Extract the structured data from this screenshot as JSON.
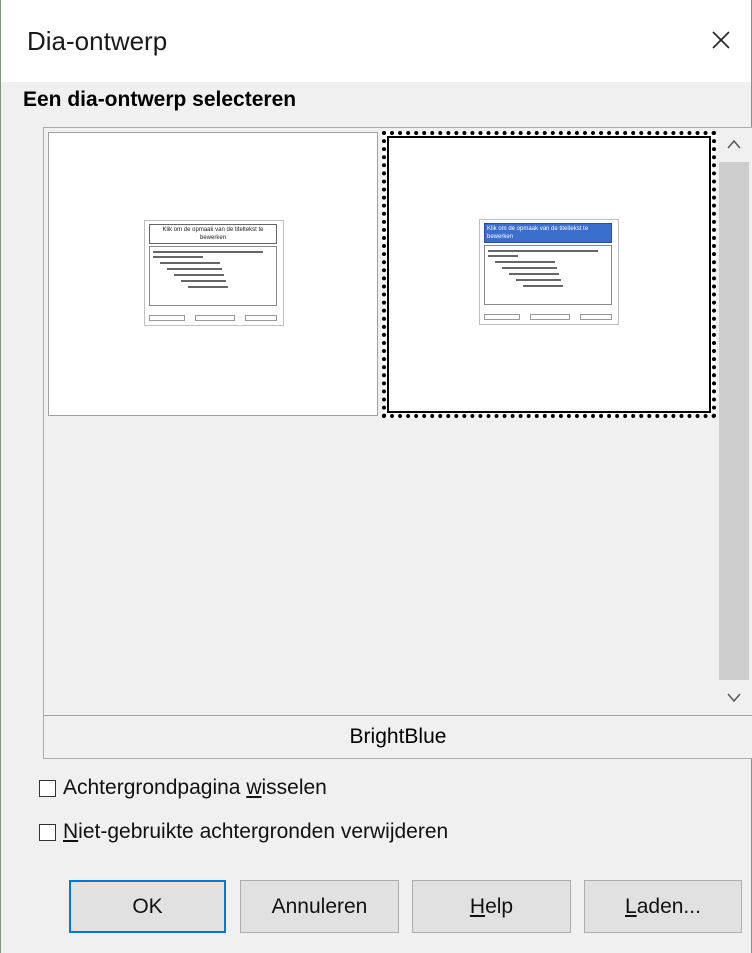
{
  "dialog": {
    "title": "Dia-ontwerp",
    "section_label": "Een dia-ontwerp selecteren"
  },
  "gallery": {
    "designs": [
      {
        "thumbnail_title": "Klik om de opmaak van de titeltekst te bewerken",
        "selected": false
      },
      {
        "thumbnail_title": "Klik om de opmaak van de titeltekst te bewerken",
        "selected": true
      }
    ],
    "selected_name": "BrightBlue"
  },
  "options": {
    "exchange_background": {
      "label_before": "Achtergrondpagina ",
      "label_underlined": "w",
      "label_after": "isselen",
      "checked": false
    },
    "delete_unused": {
      "label_before": "",
      "label_underlined": "N",
      "label_after": "iet-gebruikte achtergronden verwijderen",
      "checked": false
    }
  },
  "buttons": {
    "ok": "OK",
    "cancel": "Annuleren",
    "help_underlined": "H",
    "help_rest": "elp",
    "load_underlined": "L",
    "load_rest": "aden..."
  },
  "colors": {
    "accent": "#0078d7",
    "selected_thumb_title": "#3a6fd0"
  }
}
